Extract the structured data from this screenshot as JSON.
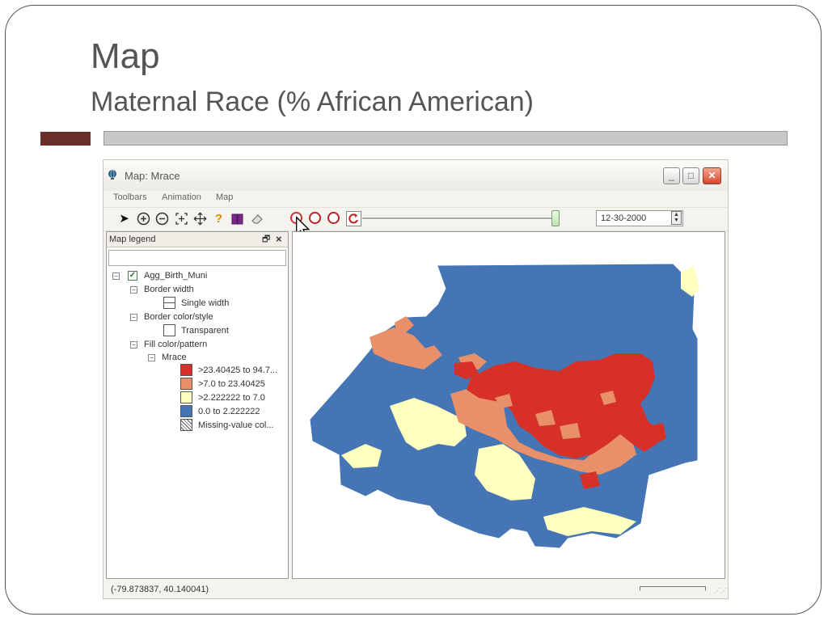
{
  "slide": {
    "title": "Map",
    "subtitle": "Maternal Race (% African American)"
  },
  "window": {
    "title": "Map: Mrace",
    "minimize_label": "_",
    "maximize_label": "□",
    "close_label": "✕"
  },
  "menu": {
    "items": [
      "Toolbars",
      "Animation",
      "Map"
    ]
  },
  "toolbar": {
    "date_value": "12-30-2000",
    "icons": [
      "select-arrow-icon",
      "zoom-in-icon",
      "zoom-out-icon",
      "zoom-extent-icon",
      "pan-icon",
      "help-icon",
      "book-icon",
      "eraser-icon",
      "play-icon",
      "fast-forward-icon",
      "stop-icon",
      "refresh-icon"
    ],
    "slider_position": 1.0
  },
  "legend": {
    "header": "Map legend",
    "pin_label": "🗗",
    "close_label": "×",
    "layer_name": "Agg_Birth_Muni",
    "border_width_label": "Border width",
    "border_width_value": "Single width",
    "border_color_label": "Border color/style",
    "border_color_value": "Transparent",
    "fill_label": "Fill color/pattern",
    "variable": "Mrace",
    "classes": [
      {
        "label": ">23.40425 to 94.7...",
        "color": "#d73027"
      },
      {
        "label": ">7.0 to 23.40425",
        "color": "#e8906a"
      },
      {
        "label": ">2.222222 to 7.0",
        "color": "#ffffbf"
      },
      {
        "label": "0.0 to 2.222222",
        "color": "#4575b4"
      },
      {
        "label": "Missing-value col...",
        "color": "hatch"
      }
    ]
  },
  "status": {
    "coordinates": "(-79.873837, 40.140041)"
  },
  "colors": {
    "accent_dark": "#6b2e2a",
    "high": "#d73027",
    "mid_high": "#e8906a",
    "mid_low": "#ffffbf",
    "low": "#4575b4"
  }
}
